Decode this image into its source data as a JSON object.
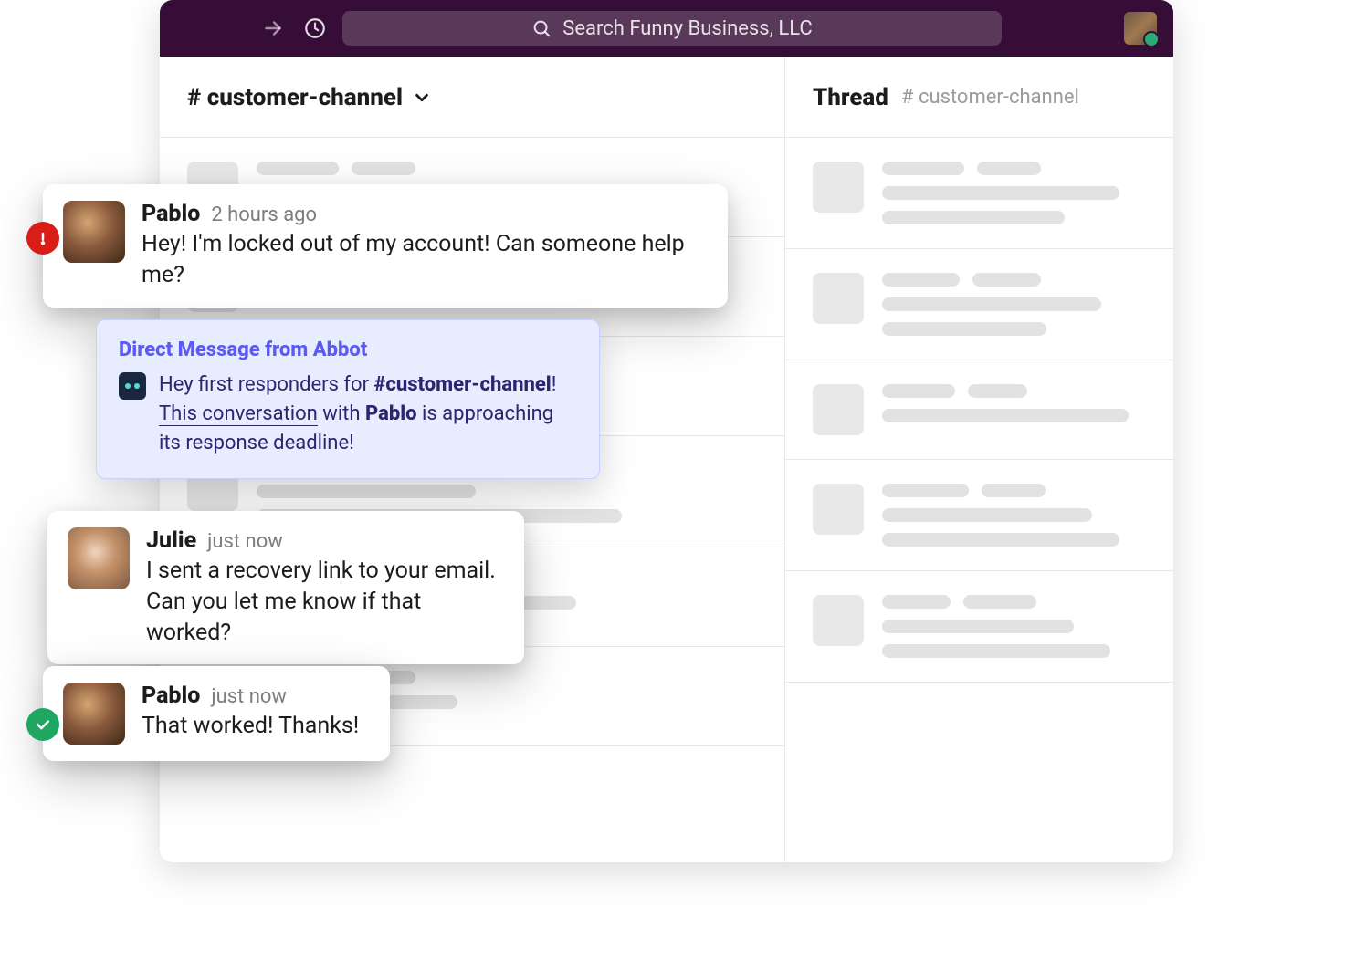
{
  "search": {
    "placeholder": "Search Funny Business, LLC"
  },
  "channel": {
    "prefix": "#",
    "name": "customer-channel"
  },
  "thread": {
    "title": "Thread",
    "sub_prefix": "#",
    "sub_name": "customer-channel"
  },
  "messages": {
    "m1": {
      "author": "Pablo",
      "time": "2 hours ago",
      "text": "Hey! I'm locked out of my account! Can someone help me?",
      "status": "alert"
    },
    "m2": {
      "author": "Julie",
      "time": "just now",
      "text": "I sent a recovery link to your email. Can you let me know if that worked?"
    },
    "m3": {
      "author": "Pablo",
      "time": "just now",
      "text": "That worked! Thanks!",
      "status": "ok"
    }
  },
  "abbot": {
    "title": "Direct Message from Abbot",
    "line1_pre": "Hey first responders for ",
    "line1_channel": "#customer-channel",
    "line1_post": "! ",
    "link_text": "This conversation",
    "line2_pre": " with ",
    "line2_person": "Pablo",
    "line2_post": " is approaching its response deadline!"
  }
}
